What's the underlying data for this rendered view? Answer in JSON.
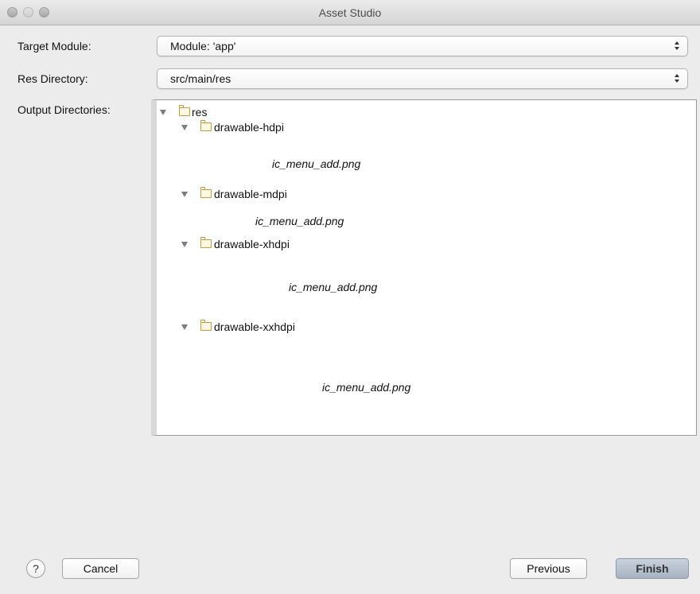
{
  "window": {
    "title": "Asset Studio"
  },
  "form": {
    "target_module_label": "Target Module:",
    "target_module_value": "Module: 'app'",
    "res_directory_label": "Res Directory:",
    "res_directory_value": "src/main/res",
    "output_directories_label": "Output Directories:"
  },
  "tree": {
    "root": "res",
    "folders": [
      {
        "name": "drawable-hdpi",
        "file": "ic_menu_add.png"
      },
      {
        "name": "drawable-mdpi",
        "file": "ic_menu_add.png"
      },
      {
        "name": "drawable-xhdpi",
        "file": "ic_menu_add.png"
      },
      {
        "name": "drawable-xxhdpi",
        "file": "ic_menu_add.png"
      }
    ]
  },
  "buttons": {
    "help": "?",
    "cancel": "Cancel",
    "previous": "Previous",
    "finish": "Finish"
  },
  "colors": {
    "folder_icon": "#c59a3d",
    "finish_button": "#b4bfcd"
  }
}
